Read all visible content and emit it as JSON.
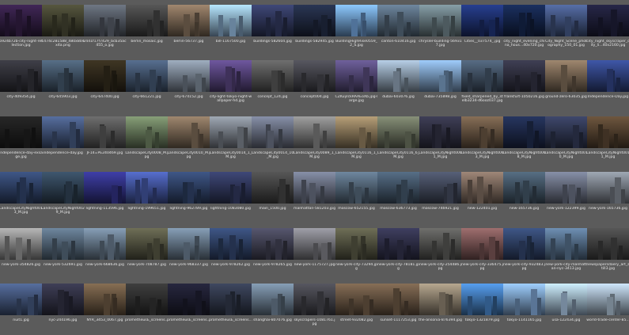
{
  "files": [
    {
      "name": "6924b72b-city-night-reflection.jpg",
      "c": "#2b1a3a"
    },
    {
      "name": "1474c281588_480x804x4a.png",
      "c": "#3a3a2a"
    },
    {
      "name": "2441f17f7429_bcb35ac455_o.jpg",
      "c": "#4a4f58"
    },
    {
      "name": "berlin_mosaic.jpg",
      "c": "#3a3a3a"
    },
    {
      "name": "berlin-56737.jpg",
      "c": "#6b5a4a"
    },
    {
      "name": "bill-1167500.jpg",
      "c": "#7a9ab8"
    },
    {
      "name": "buildings-582604.jpg",
      "c": "#2a3050"
    },
    {
      "name": "buildings-582945.jpg",
      "c": "#1c2438"
    },
    {
      "name": "BuildingHighRise0559_2_S.jpg",
      "c": "#5e86b4"
    },
    {
      "name": "canton-610416.jpg",
      "c": "#4a5a6a"
    },
    {
      "name": "chrysler-building-569317.jpg",
      "c": "#5a6a70"
    },
    {
      "name": "Cities__037574_.jpg",
      "c": "#1a2a60"
    },
    {
      "name": "city_night_evening_china_hous...40x720.jpg",
      "c": "#122040"
    },
    {
      "name": "City_Night_Scene_photography_150_01.jpg",
      "c": "#3a4a70"
    },
    {
      "name": "city_night_skyscraper_city_li...40x2160.jpg",
      "c": "#1a1a30"
    },
    {
      "name": "city-409354.jpg",
      "c": "#2a2a30"
    },
    {
      "name": "city-645903.jpg",
      "c": "#3a4a5a"
    },
    {
      "name": "city-647400.jpg",
      "c": "#2a2418"
    },
    {
      "name": "city-661221.jpg",
      "c": "#3a4a60"
    },
    {
      "name": "city-674152.jpg",
      "c": "#6a7480"
    },
    {
      "name": "city-light-tokyo-night-wallpaper-hd.jpg",
      "c": "#4a3a6a"
    },
    {
      "name": "concept_124.jpg",
      "c": "#4a4a4a"
    },
    {
      "name": "concept004.jpg",
      "c": "#3a3a40"
    },
    {
      "name": "CZKuylckRAAEoXb.jpg-large.jpg",
      "c": "#4a4068"
    },
    {
      "name": "dubai-603076.jpg",
      "c": "#7a8a9a"
    },
    {
      "name": "dubai-735898.jpg",
      "c": "#6a88a8"
    },
    {
      "name": "fixed_sharpened_by_stelb3234-d6ooz037.jpg",
      "c": "#3a4858"
    },
    {
      "name": "frankfurt-1050216.jpg",
      "c": "#2a2a38"
    },
    {
      "name": "ground-zero-63035.jpg",
      "c": "#6a5a4a"
    },
    {
      "name": "Independence-Day.jpg",
      "c": "#2a3a70"
    },
    {
      "name": "independence-day-exsage.jpg",
      "c": "#1a1a1a"
    },
    {
      "name": "independence-day.jpg",
      "c": "#3a4a6a"
    },
    {
      "name": "JF14=PE240469.jpg",
      "c": "#4a4a4a"
    },
    {
      "name": "LandscapeCity0008_M.jpg",
      "c": "#5a6a50"
    },
    {
      "name": "LandscapeCity0010_M.jpg",
      "c": "#6a5a4a"
    },
    {
      "name": "LandscapeCity0014_1_M.jpg",
      "c": "#6a7078"
    },
    {
      "name": "LandscapeCity0014_10_M.jpg",
      "c": "#5a6070"
    },
    {
      "name": "LandscapeCity0089_1_M.jpg",
      "c": "#6a6a6a"
    },
    {
      "name": "LandscapeCity0116_1_M.jpg",
      "c": "#7a6a50"
    },
    {
      "name": "LandscapeCity0116_6_M.jpg",
      "c": "#5a6050"
    },
    {
      "name": "LandscapeCityNight0001_M.jpg",
      "c": "#2a2a3a"
    },
    {
      "name": "LandscapeCityNight0003_M.jpg",
      "c": "#5a4a3a"
    },
    {
      "name": "LandscapeCityNight0008_M.jpg",
      "c": "#1a2440"
    },
    {
      "name": "LandscapeCityNight0010_M.jpg",
      "c": "#2a3048"
    },
    {
      "name": "LandscapeCityNight0011_M.jpg",
      "c": "#4a3a2a"
    },
    {
      "name": "LandscapeCityNight0013_M.jpg",
      "c": "#2a3a5a"
    },
    {
      "name": "LandscapeCityNight0029_M.jpg",
      "c": "#2a3a4a"
    },
    {
      "name": "lightning-113596.jpg",
      "c": "#2a2a70"
    },
    {
      "name": "lightning-199651.jpg",
      "c": "#3a4a8a"
    },
    {
      "name": "lightning-962789.jpg",
      "c": "#2a3a5a"
    },
    {
      "name": "lightning-1083080.jpg",
      "c": "#2a3050"
    },
    {
      "name": "main_1500.jpg",
      "c": "#3a3a3a"
    },
    {
      "name": "manhattan-581203.jpg",
      "c": "#5a6070"
    },
    {
      "name": "moscow-652155.jpg",
      "c": "#4a5a6a"
    },
    {
      "name": "moscow-636773.jpg",
      "c": "#3a4a5a"
    },
    {
      "name": "moscow-746921.jpg",
      "c": "#3a4050"
    },
    {
      "name": "new-122401.jpg",
      "c": "#6a5a50"
    },
    {
      "name": "new-165736.jpg",
      "c": "#3a4a58"
    },
    {
      "name": "new-york-122399.jpg",
      "c": "#5a6070"
    },
    {
      "name": "new-york-165736.jpg",
      "c": "#6a7078"
    },
    {
      "name": "new-york-354826.jpg",
      "c": "#7a7a7a"
    },
    {
      "name": "new-york-532691.jpg",
      "c": "#4a5a6a"
    },
    {
      "name": "new-york-668636.jpg",
      "c": "#5a6a7a"
    },
    {
      "name": "new-york-708787.jpg",
      "c": "#4a4a3a"
    },
    {
      "name": "new-york-968337.jpg",
      "c": "#5a6a7a"
    },
    {
      "name": "new-york-978262.jpg",
      "c": "#2a3a5a"
    },
    {
      "name": "new-york-978265.jpg",
      "c": "#3a3a4a"
    },
    {
      "name": "new-york-1175727.jpg",
      "c": "#6a6a70"
    },
    {
      "name": "new-york-city-73294.jpg",
      "c": "#4a4a3a"
    },
    {
      "name": "new-york-city-78181.jpg",
      "c": "#2a2a40"
    },
    {
      "name": "new-york-city-254486.jpg",
      "c": "#4a4a48"
    },
    {
      "name": "new-york-city-336475.jpg",
      "c": "#6a4a4a"
    },
    {
      "name": "new-york-city-932483.jpg",
      "c": "#2a3a5a"
    },
    {
      "name": "new-york-city-manhattan-nyc-3413.jpg",
      "c": "#4a6078"
    },
    {
      "name": "newspapersdaery_art_still3.jpg",
      "c": "#3a3a3a"
    },
    {
      "name": "nuit1.jpg",
      "c": "#3a4a6a"
    },
    {
      "name": "nyc-244196.jpg",
      "c": "#2a2a3a"
    },
    {
      "name": "NYR_3453_0067.jpg",
      "c": "#5a4a38"
    },
    {
      "name": "prometheusE_screens...",
      "c": "#2a2a2a"
    },
    {
      "name": "prometheusE_screens...",
      "c": "#1a1a2a"
    },
    {
      "name": "prometheusE_screens...",
      "c": "#2a3040"
    },
    {
      "name": "shanghai-807076.jpg",
      "c": "#5a6a7a"
    },
    {
      "name": "skyscrapers-1081761.jpg",
      "c": "#3a3a40"
    },
    {
      "name": "street-932082.jpg",
      "c": "#5a4a3a"
    },
    {
      "name": "sunset-1117253.jpg",
      "c": "#5a4a3a"
    },
    {
      "name": "the-ansonia-876394.jpg",
      "c": "#7a7060"
    },
    {
      "name": "tokyo-1321879.jpg",
      "c": "#3a6aa0"
    },
    {
      "name": "tokyo-1141165.jpg",
      "c": "#6a8ab0"
    },
    {
      "name": "usa-122434.jpg",
      "c": "#8aa0b8"
    },
    {
      "name": "world-trade-center-85...",
      "c": "#8a9aa8"
    }
  ]
}
